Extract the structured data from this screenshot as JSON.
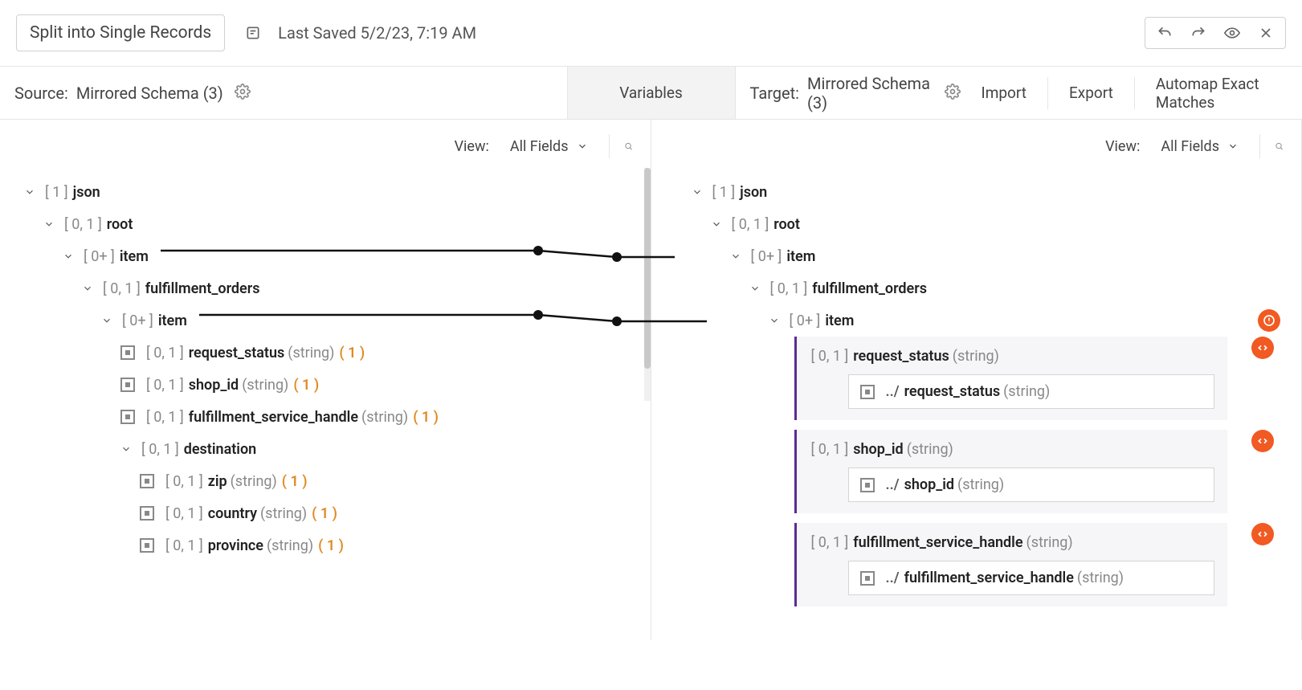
{
  "header": {
    "title": "Split into Single Records",
    "last_saved": "Last Saved 5/2/23, 7:19 AM"
  },
  "secbar": {
    "source_label": "Source:",
    "source_value": "Mirrored Schema (3)",
    "variables_tab": "Variables",
    "target_label": "Target:",
    "target_value": "Mirrored Schema (3)",
    "import": "Import",
    "export": "Export",
    "automap": "Automap Exact Matches"
  },
  "view": {
    "label": "View:",
    "value": "All Fields"
  },
  "source_tree": {
    "n0": {
      "card": "[ 1 ]",
      "name": "json"
    },
    "n1": {
      "card": "[ 0, 1 ]",
      "name": "root"
    },
    "n2": {
      "card": "[ 0+ ]",
      "name": "item"
    },
    "n3": {
      "card": "[ 0, 1 ]",
      "name": "fulfillment_orders"
    },
    "n4": {
      "card": "[ 0+ ]",
      "name": "item"
    },
    "n5": {
      "card": "[ 0, 1 ]",
      "name": "request_status",
      "type": "(string)",
      "count": "( 1 )"
    },
    "n6": {
      "card": "[ 0, 1 ]",
      "name": "shop_id",
      "type": "(string)",
      "count": "( 1 )"
    },
    "n7": {
      "card": "[ 0, 1 ]",
      "name": "fulfillment_service_handle",
      "type": "(string)",
      "count": "( 1 )"
    },
    "n8": {
      "card": "[ 0, 1 ]",
      "name": "destination"
    },
    "n9": {
      "card": "[ 0, 1 ]",
      "name": "zip",
      "type": "(string)",
      "count": "( 1 )"
    },
    "n10": {
      "card": "[ 0, 1 ]",
      "name": "country",
      "type": "(string)",
      "count": "( 1 )"
    },
    "n11": {
      "card": "[ 0, 1 ]",
      "name": "province",
      "type": "(string)",
      "count": "( 1 )"
    }
  },
  "target_tree": {
    "n0": {
      "card": "[ 1 ]",
      "name": "json"
    },
    "n1": {
      "card": "[ 0, 1 ]",
      "name": "root"
    },
    "n2": {
      "card": "[ 0+ ]",
      "name": "item"
    },
    "n3": {
      "card": "[ 0, 1 ]",
      "name": "fulfillment_orders"
    },
    "n4": {
      "card": "[ 0+ ]",
      "name": "item"
    }
  },
  "mapped": {
    "dots": "../",
    "m0": {
      "card": "[ 0, 1 ]",
      "name": "request_status",
      "type": "(string)",
      "src_name": "request_status",
      "src_type": "(string)"
    },
    "m1": {
      "card": "[ 0, 1 ]",
      "name": "shop_id",
      "type": "(string)",
      "src_name": "shop_id",
      "src_type": "(string)"
    },
    "m2": {
      "card": "[ 0, 1 ]",
      "name": "fulfillment_service_handle",
      "type": "(string)",
      "src_name": "fulfillment_service_handle",
      "src_type": "(string)"
    }
  }
}
